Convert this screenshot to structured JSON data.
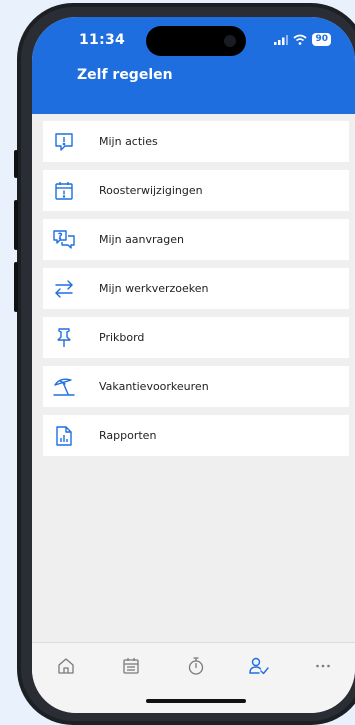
{
  "status_bar": {
    "time": "11:34",
    "battery": "90"
  },
  "header": {
    "title": "Zelf regelen"
  },
  "menu": {
    "items": [
      {
        "label": "Mijn acties",
        "icon": "alert-speech-icon"
      },
      {
        "label": "Roosterwijzigingen",
        "icon": "calendar-alert-icon"
      },
      {
        "label": "Mijn aanvragen",
        "icon": "question-chat-icon"
      },
      {
        "label": "Mijn werkverzoeken",
        "icon": "swap-arrows-icon"
      },
      {
        "label": "Prikbord",
        "icon": "pushpin-icon"
      },
      {
        "label": "Vakantievoorkeuren",
        "icon": "beach-umbrella-icon"
      },
      {
        "label": "Rapporten",
        "icon": "report-icon"
      }
    ]
  },
  "tabbar": {
    "tabs": [
      {
        "icon": "home-icon",
        "active": false
      },
      {
        "icon": "calendar-icon",
        "active": false
      },
      {
        "icon": "stopwatch-icon",
        "active": false
      },
      {
        "icon": "user-check-icon",
        "active": true
      },
      {
        "icon": "more-icon",
        "active": false
      }
    ]
  },
  "colors": {
    "accent": "#1f6ee0",
    "inactive": "#7a7a7a",
    "text": "#222222"
  }
}
